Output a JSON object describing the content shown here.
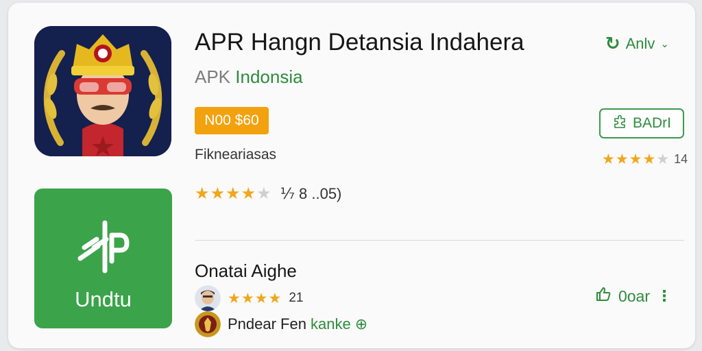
{
  "app": {
    "title": "APR Hangn Detansia Indahera",
    "subtitle_prefix": "APK",
    "subtitle_country": "Indonsia",
    "icon_name": "officer-crest-icon"
  },
  "top_action": {
    "icon": "refresh-icon",
    "label": "Anlv",
    "caret": "chevron-down-icon"
  },
  "price_badge": "N00 $60",
  "outline_button": {
    "icon": "puzzle-icon",
    "label": "BADrI"
  },
  "category": "Fikneariasas",
  "side_rating": {
    "stars": 4,
    "count": "14"
  },
  "main_rating": {
    "stars": 4,
    "summary": "⅐ 8 ..05)"
  },
  "download_tile": {
    "label": "Undtu",
    "glyph": "ap-logo-icon"
  },
  "section": {
    "title": "Onatai Aighe"
  },
  "reviews": [
    {
      "avatar": "user-avatar",
      "stars": 4,
      "count": "21"
    },
    {
      "avatar": "crest-avatar",
      "name": "Pndear Fen",
      "link": "kanke"
    }
  ],
  "bottom_action": {
    "icon": "thumbs-up-icon",
    "label": "0oar",
    "menu": "kebab-menu-icon"
  },
  "colors": {
    "accent_green": "#2e8b3d",
    "tile_green": "#3ba34a",
    "badge_orange": "#f2a20f",
    "star": "#f1a61c"
  }
}
